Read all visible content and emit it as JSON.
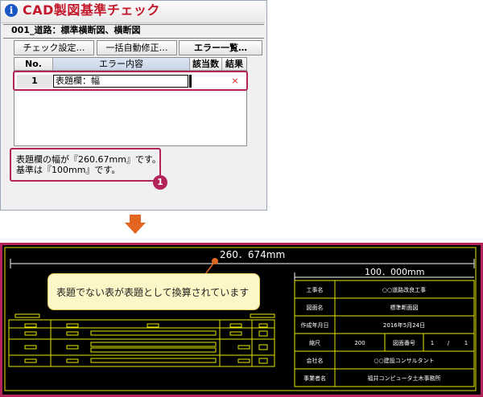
{
  "app": {
    "title": "CAD製図基準チェック"
  },
  "document": {
    "name": "001_道路：標準横断図、横断図"
  },
  "toolbar": {
    "check_settings": "チェック設定…",
    "auto_fix": "一括自動修正…",
    "error_list": "エラー一覧…"
  },
  "grid": {
    "headers": [
      "No.",
      "エラー内容",
      "該当数",
      "結果"
    ],
    "rows": [
      {
        "no": "1",
        "content": "表題欄：幅",
        "count": "",
        "result": "×"
      }
    ]
  },
  "message": {
    "line1": "表題欄の幅が『260.67mm』です。",
    "line2": "基準は『100mm』です。"
  },
  "annotation": {
    "badge": "1"
  },
  "drawing": {
    "dim_total": "260．674mm",
    "dim_title": "100．000mm",
    "callout": "表題でない表が表題として換算されています",
    "title_block": [
      {
        "label": "工事名",
        "value": "○○道路改良工事"
      },
      {
        "label": "図面名",
        "value": "標準断面図"
      },
      {
        "label": "作成年月日",
        "value": "2016年5月24日"
      },
      {
        "label": "縮尺",
        "value": "200",
        "label2": "図面番号",
        "value2": "1",
        "slash": "/",
        "value3": "1"
      },
      {
        "label": "会社名",
        "value": "○○建設コンサルタント"
      },
      {
        "label": "事業者名",
        "value": "福井コンピュータ土木事務所"
      }
    ]
  },
  "colors": {
    "accent": "#b3245a",
    "arrow": "#e2661f",
    "cad_line": "#e8e800",
    "title_red": "#c3172a"
  }
}
